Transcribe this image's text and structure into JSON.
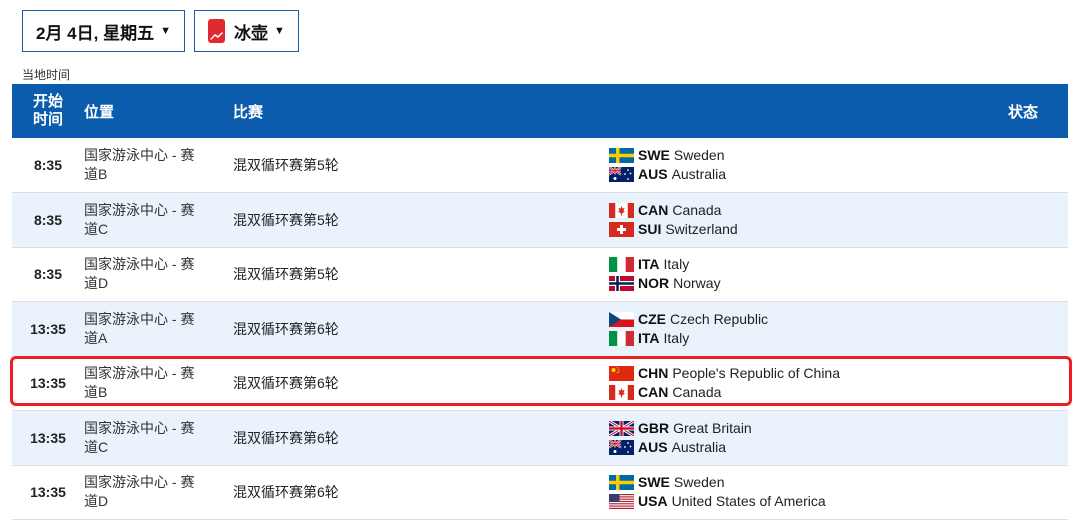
{
  "controls": {
    "date_label": "2月 4日, 星期五",
    "sport_label": "冰壶"
  },
  "timezone_note": "当地时间",
  "table": {
    "headers": {
      "start_line1": "开始",
      "start_line2": "时间",
      "venue": "位置",
      "event": "比赛",
      "status": "状态"
    },
    "rows": [
      {
        "time": "8:35",
        "venue_line1": "国家游泳中心 - 赛",
        "venue_line2": "道B",
        "event": "混双循环赛第5轮",
        "team1": {
          "code": "SWE",
          "name": "Sweden",
          "flag": "sweden-flag"
        },
        "team2": {
          "code": "AUS",
          "name": "Australia",
          "flag": "australia-flag"
        }
      },
      {
        "time": "8:35",
        "venue_line1": "国家游泳中心 - 赛",
        "venue_line2": "道C",
        "event": "混双循环赛第5轮",
        "team1": {
          "code": "CAN",
          "name": "Canada",
          "flag": "canada-flag"
        },
        "team2": {
          "code": "SUI",
          "name": "Switzerland",
          "flag": "switzerland-flag"
        }
      },
      {
        "time": "8:35",
        "venue_line1": "国家游泳中心 - 赛",
        "venue_line2": "道D",
        "event": "混双循环赛第5轮",
        "team1": {
          "code": "ITA",
          "name": "Italy",
          "flag": "italy-flag"
        },
        "team2": {
          "code": "NOR",
          "name": "Norway",
          "flag": "norway-flag"
        }
      },
      {
        "time": "13:35",
        "venue_line1": "国家游泳中心 - 赛",
        "venue_line2": "道A",
        "event": "混双循环赛第6轮",
        "team1": {
          "code": "CZE",
          "name": "Czech Republic",
          "flag": "czech-flag"
        },
        "team2": {
          "code": "ITA",
          "name": "Italy",
          "flag": "italy-flag"
        }
      },
      {
        "time": "13:35",
        "venue_line1": "国家游泳中心 - 赛",
        "venue_line2": "道B",
        "event": "混双循环赛第6轮",
        "team1": {
          "code": "CHN",
          "name": "People's Republic of China",
          "flag": "china-flag"
        },
        "team2": {
          "code": "CAN",
          "name": "Canada",
          "flag": "canada-flag"
        }
      },
      {
        "time": "13:35",
        "venue_line1": "国家游泳中心 - 赛",
        "venue_line2": "道C",
        "event": "混双循环赛第6轮",
        "team1": {
          "code": "GBR",
          "name": "Great Britain",
          "flag": "great-britain-flag"
        },
        "team2": {
          "code": "AUS",
          "name": "Australia",
          "flag": "australia-flag"
        }
      },
      {
        "time": "13:35",
        "venue_line1": "国家游泳中心 - 赛",
        "venue_line2": "道D",
        "event": "混双循环赛第6轮",
        "team1": {
          "code": "SWE",
          "name": "Sweden",
          "flag": "sweden-flag"
        },
        "team2": {
          "code": "USA",
          "name": "United States of America",
          "flag": "usa-flag"
        }
      }
    ]
  },
  "colors": {
    "header_bg": "#0b5cad",
    "alt_row_bg": "#eaf3fb",
    "highlight_border": "#ee1d24",
    "sport_icon": "#e02a30"
  }
}
